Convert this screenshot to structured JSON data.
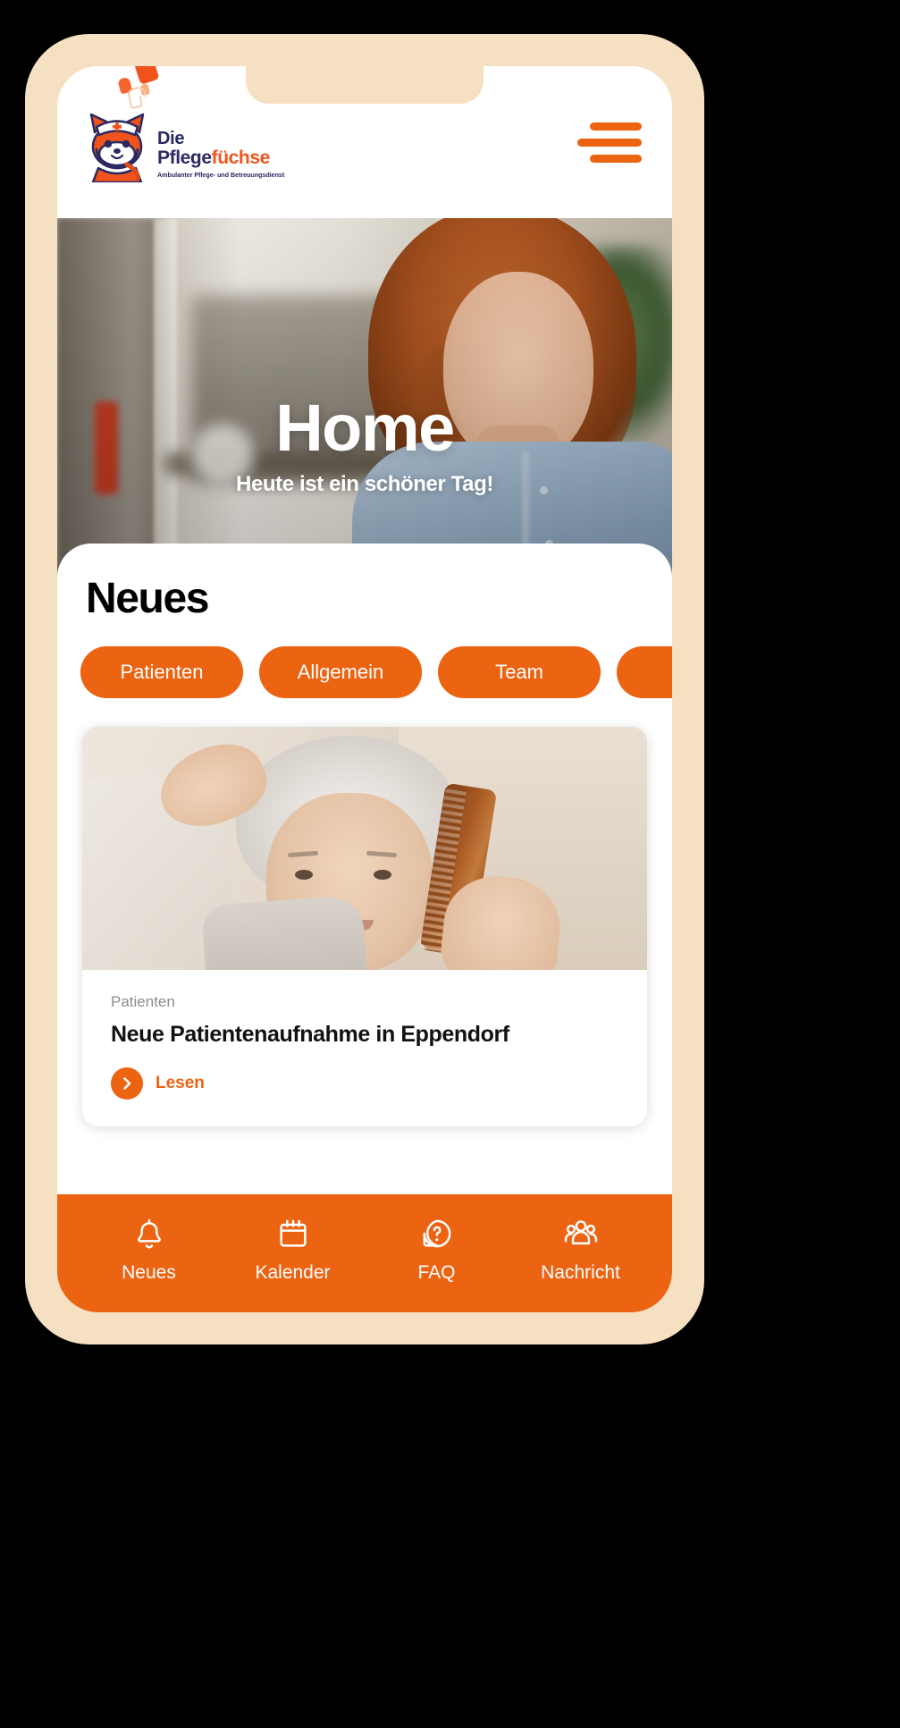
{
  "app": {
    "brand": {
      "line1": "Die",
      "line2_part1": "Pflege",
      "line2_part2": "füchse",
      "tagline": "Ambulanter Pflege- und Betreuungsdienst",
      "logo_icon": "fox-nurse-logo",
      "hearts_icon": "hearts-icon"
    },
    "menu_button_icon": "hamburger-menu-icon"
  },
  "hero": {
    "title": "Home",
    "subtitle": "Heute ist ein schöner Tag!",
    "image_alt": "smiling-caregiver-photo"
  },
  "news": {
    "heading": "Neues",
    "chips": [
      {
        "label": "Patienten"
      },
      {
        "label": "Allgemein"
      },
      {
        "label": "Team"
      },
      {
        "label": ""
      }
    ],
    "article": {
      "category": "Patienten",
      "title": "Neue Patientenaufnahme in Eppendorf",
      "read_label": "Lesen",
      "read_arrow_icon": "chevron-right-icon",
      "image_alt": "elderly-woman-being-combed-photo"
    }
  },
  "bottom_nav": {
    "items": [
      {
        "label": "Neues",
        "icon": "bell-icon"
      },
      {
        "label": "Kalender",
        "icon": "calendar-icon"
      },
      {
        "label": "FAQ",
        "icon": "question-bubble-icon"
      },
      {
        "label": "Nachricht",
        "icon": "people-group-icon"
      }
    ]
  },
  "colors": {
    "brand_orange": "#ec6312",
    "logo_orange": "#f0531c",
    "navy": "#2a2a63",
    "phone_frame": "#f6e0c2",
    "background": "#000000"
  }
}
